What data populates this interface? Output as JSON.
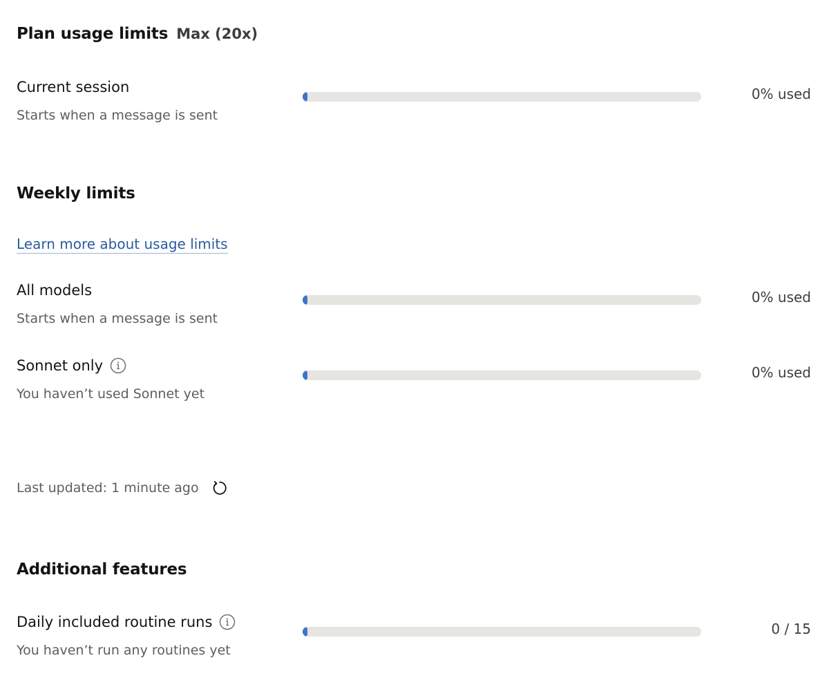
{
  "header": {
    "title": "Plan usage limits",
    "plan": "Max (20x)"
  },
  "current_session": {
    "label": "Current session",
    "subtitle": "Starts when a message is sent",
    "usage_percent": 0,
    "usage_text": "0% used"
  },
  "weekly": {
    "title": "Weekly limits",
    "learn_more": "Learn more about usage limits",
    "all_models": {
      "label": "All models",
      "subtitle": "Starts when a message is sent",
      "usage_percent": 0,
      "usage_text": "0% used"
    },
    "sonnet_only": {
      "label": "Sonnet only",
      "subtitle": "You haven’t used Sonnet yet",
      "usage_percent": 0,
      "usage_text": "0% used",
      "icon": "info-icon"
    }
  },
  "last_updated": {
    "text": "Last updated: 1 minute ago",
    "icon": "refresh-icon"
  },
  "additional": {
    "title": "Additional features",
    "routine_runs": {
      "label": "Daily included routine runs",
      "subtitle": "You haven’t run any routines yet",
      "used": 0,
      "total": 15,
      "usage_text": "0 / 15",
      "icon": "info-icon"
    }
  },
  "colors": {
    "bar_fill": "#3e74c8",
    "bar_track": "#e6e5e2",
    "link": "#2c5aa0"
  }
}
